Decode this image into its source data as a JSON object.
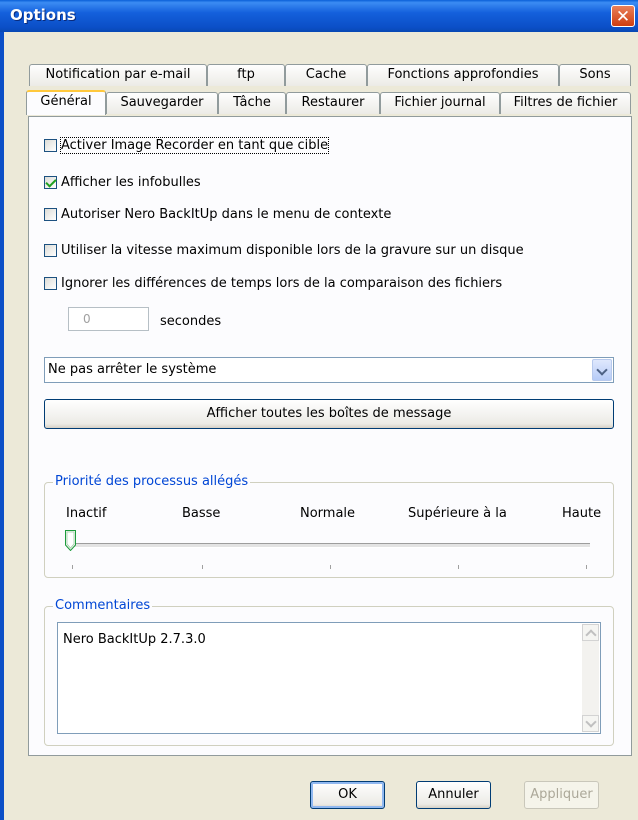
{
  "window": {
    "title": "Options"
  },
  "tabs_row1": [
    {
      "label": "Notification par e-mail"
    },
    {
      "label": "ftp"
    },
    {
      "label": "Cache"
    },
    {
      "label": "Fonctions approfondies"
    },
    {
      "label": "Sons"
    }
  ],
  "tabs_row2": [
    {
      "label": "Général",
      "active": true
    },
    {
      "label": "Sauvegarder"
    },
    {
      "label": "Tâche"
    },
    {
      "label": "Restaurer"
    },
    {
      "label": "Fichier journal"
    },
    {
      "label": "Filtres de fichier"
    }
  ],
  "options": [
    {
      "label": "Activer Image Recorder en tant que cible",
      "checked": false
    },
    {
      "label": "Afficher les infobulles",
      "checked": true
    },
    {
      "label": "Autoriser Nero BackItUp dans le menu de contexte",
      "checked": false
    },
    {
      "label": "Utiliser la vitesse maximum disponible lors de la gravure sur un disque",
      "checked": false
    },
    {
      "label": "Ignorer les différences de temps lors de la comparaison des fichiers",
      "checked": false
    }
  ],
  "seconds": {
    "value": "0",
    "label": "secondes"
  },
  "shutdown_select": {
    "value": "Ne pas arrêter le système"
  },
  "show_messages_button": "Afficher toutes les boîtes de message",
  "priority": {
    "legend": "Priorité des processus allégés",
    "levels": [
      "Inactif",
      "Basse",
      "Normale",
      "Supérieure à la",
      "Haute"
    ],
    "selected_index": 0
  },
  "comments": {
    "legend": "Commentaires",
    "text": "Nero BackItUp 2.7.3.0"
  },
  "buttons": {
    "ok": "OK",
    "cancel": "Annuler",
    "apply": "Appliquer"
  },
  "colors": {
    "titlebar": "#0b4fc7",
    "group_legend": "#0046d5",
    "active_tab_accent": "#ffc83c"
  }
}
